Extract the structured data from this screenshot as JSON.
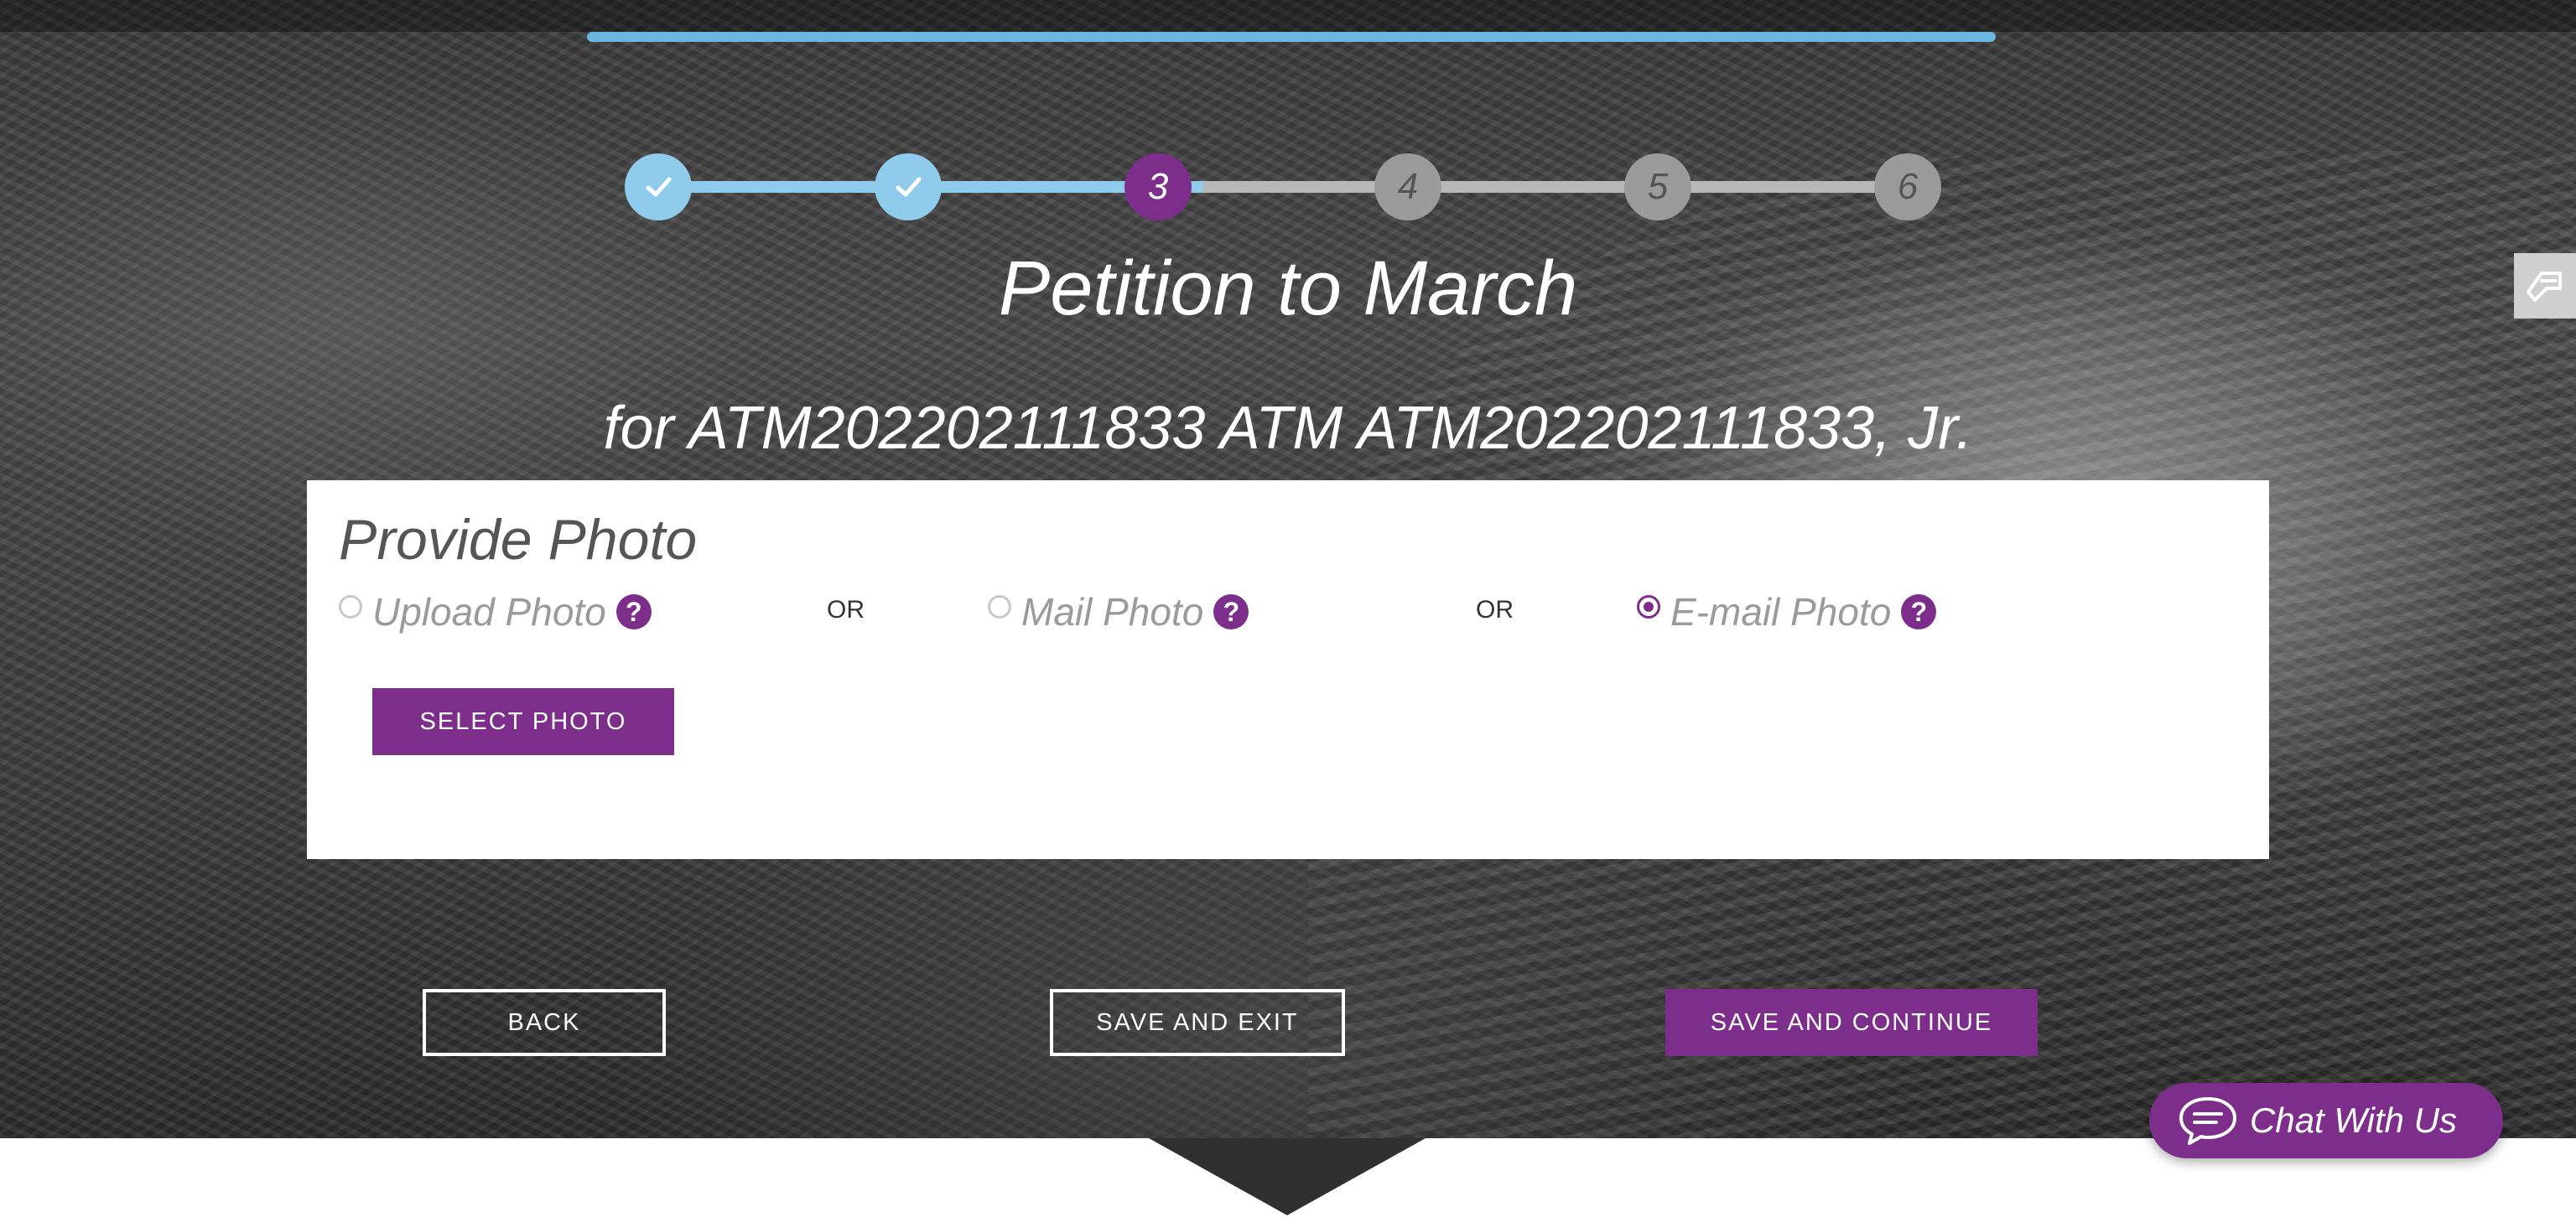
{
  "stepper": {
    "steps": [
      {
        "label": "",
        "status": "done"
      },
      {
        "label": "",
        "status": "done"
      },
      {
        "label": "3",
        "status": "current"
      },
      {
        "label": "4",
        "status": "todo"
      },
      {
        "label": "5",
        "status": "todo"
      },
      {
        "label": "6",
        "status": "todo"
      }
    ]
  },
  "header": {
    "title": "Petition to March",
    "subtitle": "for ATM202202111833 ATM ATM202202111833, Jr."
  },
  "photo": {
    "title": "Provide Photo",
    "options": [
      {
        "label": "Upload Photo",
        "selected": false
      },
      {
        "label": "Mail Photo",
        "selected": false
      },
      {
        "label": "E-mail Photo",
        "selected": true
      }
    ],
    "or_label": "OR",
    "help_glyph": "?",
    "select_button": "SELECT PHOTO"
  },
  "actions": {
    "back": "BACK",
    "save_exit": "SAVE AND EXIT",
    "save_continue": "SAVE AND CONTINUE"
  },
  "chat": {
    "label": "Chat With Us",
    "icon": "chat-bubble-icon"
  },
  "colors": {
    "accent": "#7d2e8b",
    "progress": "#8fcbea",
    "inactive": "#9b9b9b"
  }
}
